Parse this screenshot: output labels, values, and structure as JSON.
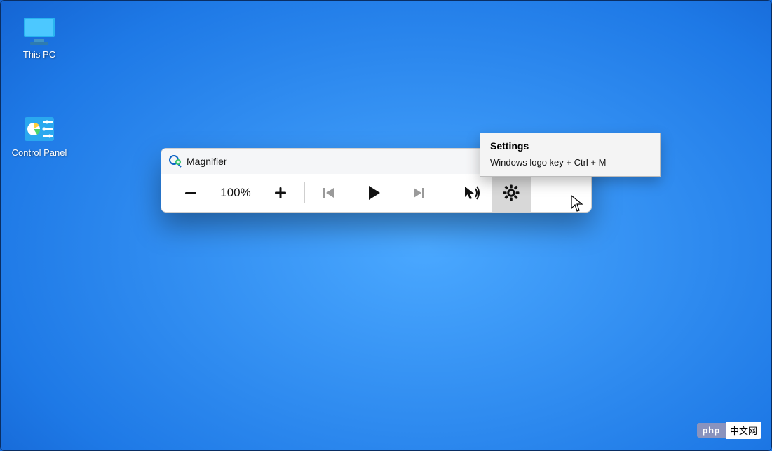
{
  "desktop": {
    "this_pc_label": "This PC",
    "control_panel_label": "Control Panel"
  },
  "magnifier": {
    "title": "Magnifier",
    "zoom_value": "100%",
    "minimize_glyph": "—"
  },
  "tooltip": {
    "title": "Settings",
    "shortcut": "Windows logo key + Ctrl + M"
  },
  "footer": {
    "php": "php",
    "cn": "中文网"
  }
}
